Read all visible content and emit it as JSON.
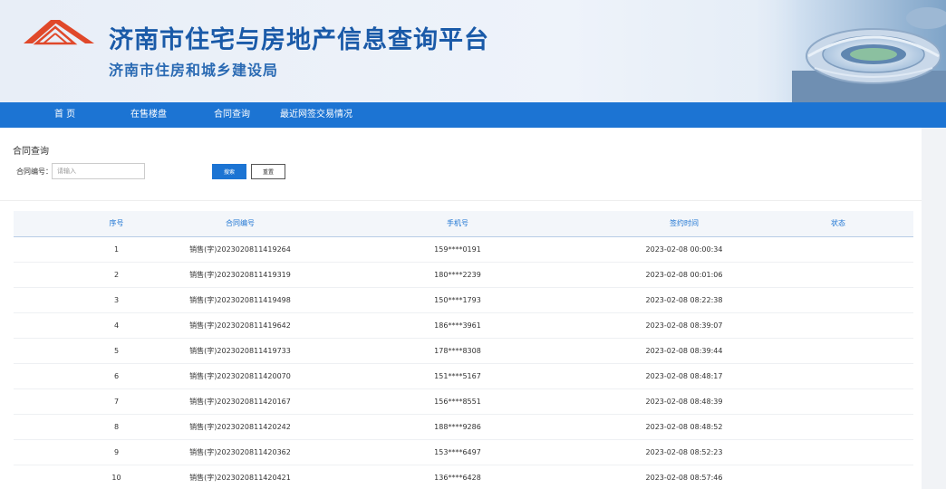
{
  "header": {
    "title": "济南市住宅与房地产信息查询平台",
    "subtitle": "济南市住房和城乡建设局",
    "brand_color": "#1a5aa8",
    "logo_color": "#e0482a"
  },
  "nav": {
    "items": [
      {
        "label": "首  页"
      },
      {
        "label": "在售楼盘"
      },
      {
        "label": "合同查询"
      },
      {
        "label": "最近网签交易情况"
      }
    ],
    "color": "#1c74d3"
  },
  "query": {
    "section_title": "合同查询",
    "field_label": "合同编号：",
    "input_placeholder": "请输入",
    "input_value": "",
    "search_label": "搜索",
    "reset_label": "重置"
  },
  "table": {
    "headers": {
      "no": "序号",
      "contract": "合同编号",
      "phone": "手机号",
      "time": "签约时间",
      "status": "状态"
    },
    "rows": [
      {
        "no": "1",
        "contract": "销售(字)2023020811419264",
        "phone": "159****0191",
        "time": "2023-02-08 00:00:34",
        "status": ""
      },
      {
        "no": "2",
        "contract": "销售(字)2023020811419319",
        "phone": "180****2239",
        "time": "2023-02-08 00:01:06",
        "status": ""
      },
      {
        "no": "3",
        "contract": "销售(字)2023020811419498",
        "phone": "150****1793",
        "time": "2023-02-08 08:22:38",
        "status": ""
      },
      {
        "no": "4",
        "contract": "销售(字)2023020811419642",
        "phone": "186****3961",
        "time": "2023-02-08 08:39:07",
        "status": ""
      },
      {
        "no": "5",
        "contract": "销售(字)2023020811419733",
        "phone": "178****8308",
        "time": "2023-02-08 08:39:44",
        "status": ""
      },
      {
        "no": "6",
        "contract": "销售(字)2023020811420070",
        "phone": "151****5167",
        "time": "2023-02-08 08:48:17",
        "status": ""
      },
      {
        "no": "7",
        "contract": "销售(字)2023020811420167",
        "phone": "156****8551",
        "time": "2023-02-08 08:48:39",
        "status": ""
      },
      {
        "no": "8",
        "contract": "销售(字)2023020811420242",
        "phone": "188****9286",
        "time": "2023-02-08 08:48:52",
        "status": ""
      },
      {
        "no": "9",
        "contract": "销售(字)2023020811420362",
        "phone": "153****6497",
        "time": "2023-02-08 08:52:23",
        "status": ""
      },
      {
        "no": "10",
        "contract": "销售(字)2023020811420421",
        "phone": "136****6428",
        "time": "2023-02-08 08:57:46",
        "status": ""
      }
    ]
  }
}
